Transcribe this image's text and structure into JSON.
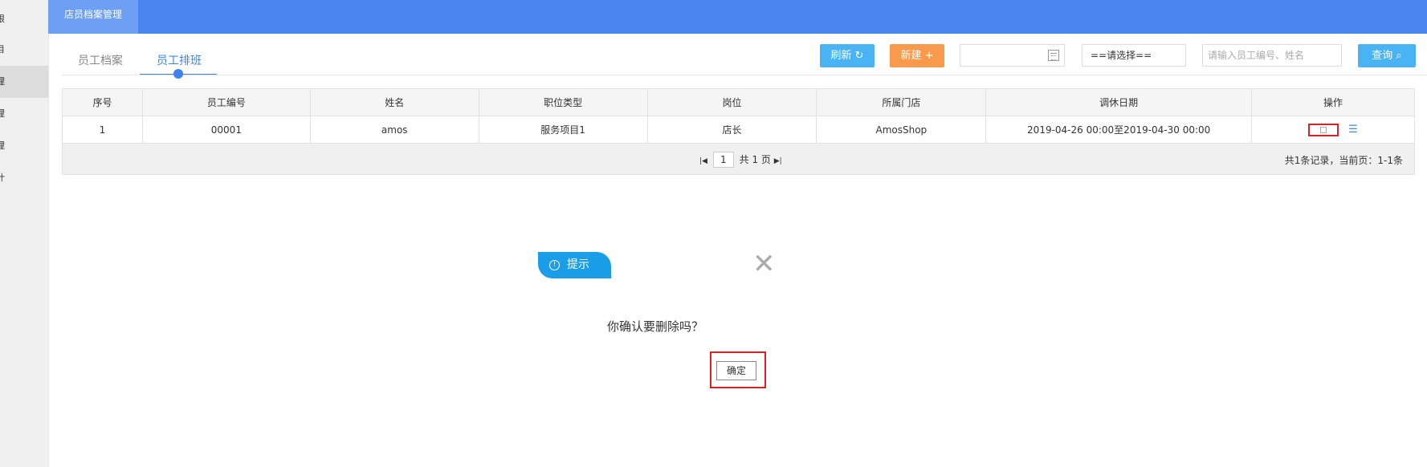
{
  "sidebar": {
    "items": [
      "限",
      "目",
      "理",
      "理",
      "理",
      "计"
    ]
  },
  "topbar": {
    "active_tab": "店员档案管理"
  },
  "tabs": [
    "员工档案",
    "员工排班"
  ],
  "toolbar": {
    "refresh_label": "刷新 ↻",
    "new_label": "新建 +",
    "select_value": "==请选择==",
    "search_placeholder": "请输入员工编号、姓名",
    "query_label": "查询 ⌕"
  },
  "table": {
    "headers": [
      "序号",
      "员工编号",
      "姓名",
      "职位类型",
      "岗位",
      "所属门店",
      "调休日期",
      "操作"
    ],
    "rows": [
      [
        "1",
        "00001",
        "amos",
        "服务项目1",
        "店长",
        "AmosShop",
        "2019-04-26 00:00至2019-04-30 00:00"
      ]
    ]
  },
  "pager": {
    "current_page": "1",
    "total_pages": "共 1 页",
    "info": "共1条记录，当前页：1-1条"
  },
  "dialog": {
    "title": "提示",
    "message": "你确认要删除吗？",
    "ok_label": "确定"
  },
  "colors": {
    "primary": "#4a86f0",
    "info": "#4ab3f4",
    "warning": "#f79a4b",
    "highlight": "#e02020"
  }
}
